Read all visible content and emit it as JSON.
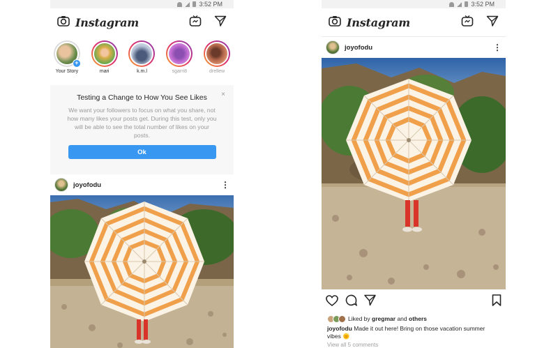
{
  "status_bar": {
    "time": "3:52 PM"
  },
  "header": {
    "brand": "Instagram",
    "camera_icon": "camera-icon",
    "igtv_icon": "igtv-icon",
    "direct_icon": "direct-message-icon"
  },
  "stories": [
    {
      "name": "Your Story",
      "own": true
    },
    {
      "name": "mari",
      "own": false
    },
    {
      "name": "k.m.l",
      "own": false
    },
    {
      "name": "sgarri8",
      "own": false
    },
    {
      "name": "drellew",
      "own": false
    }
  ],
  "notice": {
    "title": "Testing a Change to How You See Likes",
    "body": "We want your followers to focus on what you share, not how many likes your posts get. During this test, only you will be able to see the total number of likes on your posts.",
    "ok_label": "Ok",
    "close_label": "×"
  },
  "post": {
    "username": "joyofodu",
    "more_label": "⋮",
    "liked_by_prefix": "Liked by",
    "liked_by_user": "gregmar",
    "liked_by_and": "and",
    "liked_by_others": "others",
    "caption_user": "joyofodu",
    "caption_text": "Made it out here! Bring on those vacation summer vibes 🌞",
    "view_comments": "View all 5 comments"
  },
  "colors": {
    "accent": "#3897f0",
    "notice_bg": "#f7f7f7",
    "umbrella_stripe": "#f0a04b"
  }
}
